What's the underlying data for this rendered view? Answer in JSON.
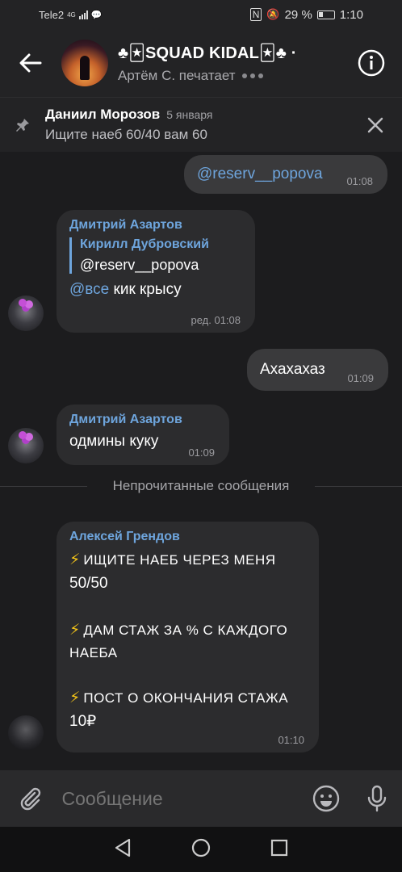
{
  "status_bar": {
    "carrier": "Tele2",
    "network": "4G",
    "battery": "29 %",
    "time": "1:10"
  },
  "header": {
    "title": "♣🃏SQUAD KIDAL🃏♣ ·",
    "typing": "Артём С. печатает"
  },
  "pinned": {
    "author": "Даниил Морозов",
    "date": "5 января",
    "text": "Ищите наеб 60/40 вам 60"
  },
  "messages": [
    {
      "type": "out",
      "text": "@reserv__popova",
      "time": "01:08"
    },
    {
      "type": "in",
      "sender": "Дмитрий Азартов",
      "reply_name": "Кирилл Дубровский",
      "reply_text": "@reserv__popova",
      "mention": "@все",
      "text": " кик крысу",
      "time": "ред. 01:08"
    },
    {
      "type": "out",
      "text": "Ахахахаз",
      "time": "01:09"
    },
    {
      "type": "in",
      "sender": "Дмитрий Азартов",
      "text": "одмины куку",
      "time": "01:09"
    },
    {
      "type": "in",
      "sender": "Алексей Грендов",
      "line1": "ИЩИТЕ НАЕБ ЧЕРЕЗ МЕНЯ",
      "line2": "50/50",
      "line3": "ДАМ СТАЖ ЗА % С КАЖДОГО",
      "line4": "НАЕБА",
      "line5": "ПОСТ О ОКОНЧАНИЯ СТАЖА",
      "line6": "10₽",
      "time": "01:10"
    }
  ],
  "unread_label": "Непрочитанные сообщения",
  "composer": {
    "placeholder": "Сообщение"
  },
  "colors": {
    "accent": "#6ea5dd",
    "background": "#1c1c1e",
    "bubble_in": "#2c2c2e",
    "bubble_out": "#3a3a3c"
  }
}
